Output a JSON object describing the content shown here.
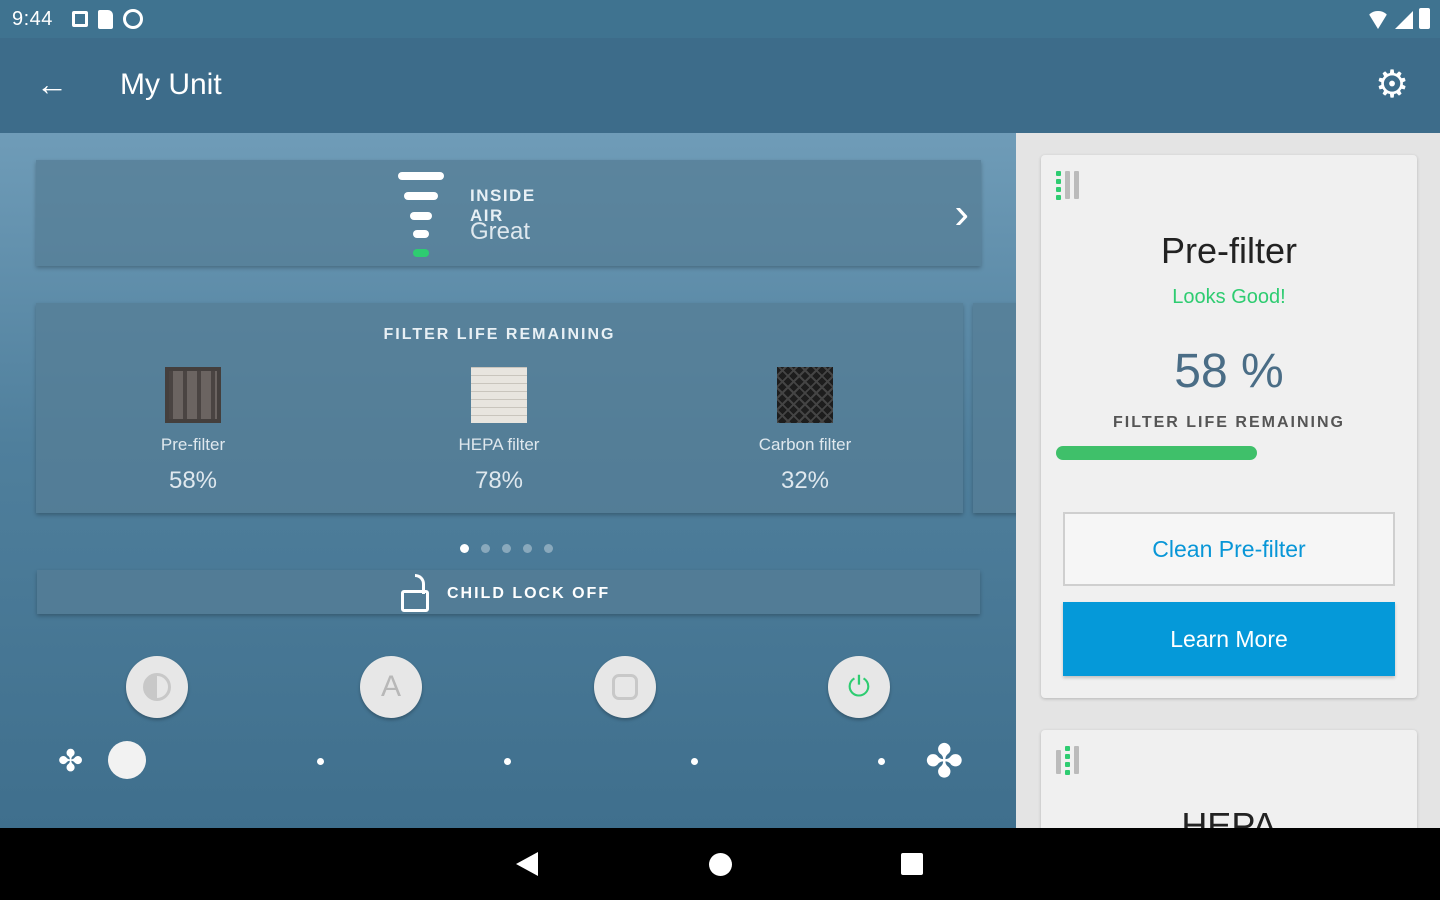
{
  "status_bar": {
    "time": "9:44",
    "icons_left": [
      "notification-a-icon",
      "sd-card-icon",
      "sync-icon"
    ],
    "icons_right": [
      "wifi-icon",
      "signal-icon",
      "battery-icon"
    ]
  },
  "app_bar": {
    "title": "My Unit",
    "back_icon": "←",
    "settings_icon": "⚙"
  },
  "inside_air": {
    "label": "INSIDE AIR",
    "value": "Great",
    "chevron": "›"
  },
  "filter_life": {
    "title": "FILTER LIFE REMAINING",
    "items": [
      {
        "name": "Pre-filter",
        "percent": "58%"
      },
      {
        "name": "HEPA filter",
        "percent": "78%"
      },
      {
        "name": "Carbon filter",
        "percent": "32%"
      }
    ]
  },
  "pager": {
    "count": 5,
    "active": 0
  },
  "child_lock": {
    "label": "CHILD LOCK OFF"
  },
  "modes": {
    "auto_label": "A",
    "power_icon": "⏻"
  },
  "fan": {
    "low_icon": "✤",
    "high_icon": "✤",
    "speed_level": 0,
    "speed_steps": 5
  },
  "prefilter_card": {
    "title": "Pre-filter",
    "status": "Looks Good!",
    "percent": "58 %",
    "percent_label": "FILTER LIFE REMAINING",
    "progress": 0.58,
    "clean_button": "Clean Pre-filter",
    "learn_button": "Learn More"
  },
  "hepa_card": {
    "title": "HEPA"
  },
  "colors": {
    "accent_green": "#2ecc71",
    "primary_blue": "#0599d9",
    "app_bar": "#3d6c8a"
  }
}
